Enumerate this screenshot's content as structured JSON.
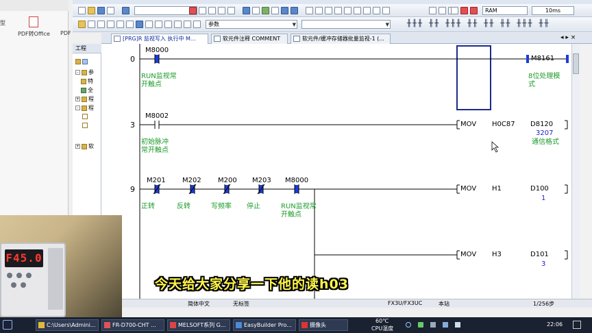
{
  "left_panel": {
    "labels": [
      "型",
      "PDF转Office",
      "PDF"
    ]
  },
  "toolbar": {
    "combo_program": "",
    "ram_label": "RAM",
    "scan_time": "10ms",
    "combo_param": "参数"
  },
  "tabs": [
    {
      "label": "[PRG]R 监视写入 执行中 M..."
    },
    {
      "label": "软元件注释 COMMENT"
    },
    {
      "label": "软元件/缓冲存储器批量监视-1 (..."
    }
  ],
  "tab_nav": "◂ ▸  ×",
  "project": {
    "header": "工程",
    "items": [
      {
        "expander": "-",
        "label": "参"
      },
      {
        "expander": "",
        "label": "特"
      },
      {
        "expander": "",
        "label": "全"
      },
      {
        "expander": "+",
        "label": "程"
      },
      {
        "expander": "-",
        "label": "程"
      },
      {
        "expander": "",
        "label": ""
      },
      {
        "expander": "",
        "label": ""
      },
      {
        "expander": "+",
        "label": "软"
      }
    ]
  },
  "rungs": [
    {
      "step": "0",
      "contacts": [
        {
          "device": "M8000",
          "comment": [
            "RUN监视常",
            "开触点"
          ],
          "type": "no",
          "on": true
        }
      ],
      "coil": {
        "device": "M8161",
        "comment": [
          "8位处理模",
          "式"
        ]
      }
    },
    {
      "step": "3",
      "contacts": [
        {
          "device": "M8002",
          "comment": [
            "初始脉冲",
            "常开触点"
          ],
          "type": "no",
          "on": false
        }
      ],
      "instr": {
        "op": "MOV",
        "src": "H0C87",
        "dst": "D8120",
        "monitor": "3207",
        "dst_comment": "通信格式"
      }
    },
    {
      "step": "9",
      "contacts": [
        {
          "device": "M201",
          "comment": [
            "正转"
          ],
          "type": "nc",
          "on": true
        },
        {
          "device": "M202",
          "comment": [
            "反转"
          ],
          "type": "nc",
          "on": true
        },
        {
          "device": "M200",
          "comment": [
            "写频率"
          ],
          "type": "nc",
          "on": true
        },
        {
          "device": "M203",
          "comment": [
            "停止"
          ],
          "type": "nc",
          "on": true
        },
        {
          "device": "M8000",
          "comment": [
            "RUN监视常",
            "开触点"
          ],
          "type": "no",
          "on": true
        }
      ],
      "instr": {
        "op": "MOV",
        "src": "H1",
        "dst": "D100",
        "monitor": "1"
      },
      "branch": {
        "op": "MOV",
        "src": "H3",
        "dst": "D101",
        "monitor": "3"
      }
    }
  ],
  "status": {
    "language": "简体中文",
    "title_status": "无标签",
    "cpu": "FX3U/FX3UC",
    "station": "本站",
    "step_info": "1/256步"
  },
  "taskbar": {
    "items": [
      {
        "label": "C:\\Users\\Admini..."
      },
      {
        "label": "FR-D700-CHT ..."
      },
      {
        "label": "MELSOFT系列 G..."
      },
      {
        "label": "EasyBuilder Pro..."
      },
      {
        "label": "摄像头"
      }
    ],
    "temp": "60℃",
    "temp_label": "CPU温度",
    "time": "22:06"
  },
  "webcam": {
    "display": "F45.0"
  },
  "subtitle": "今天给大家分享一下他的读h03",
  "colors": {
    "comment": "#1c9b2a",
    "monitor": "#1b1bd6",
    "contact_on": "#1a3cd8",
    "subtitle": "#fff64a"
  }
}
